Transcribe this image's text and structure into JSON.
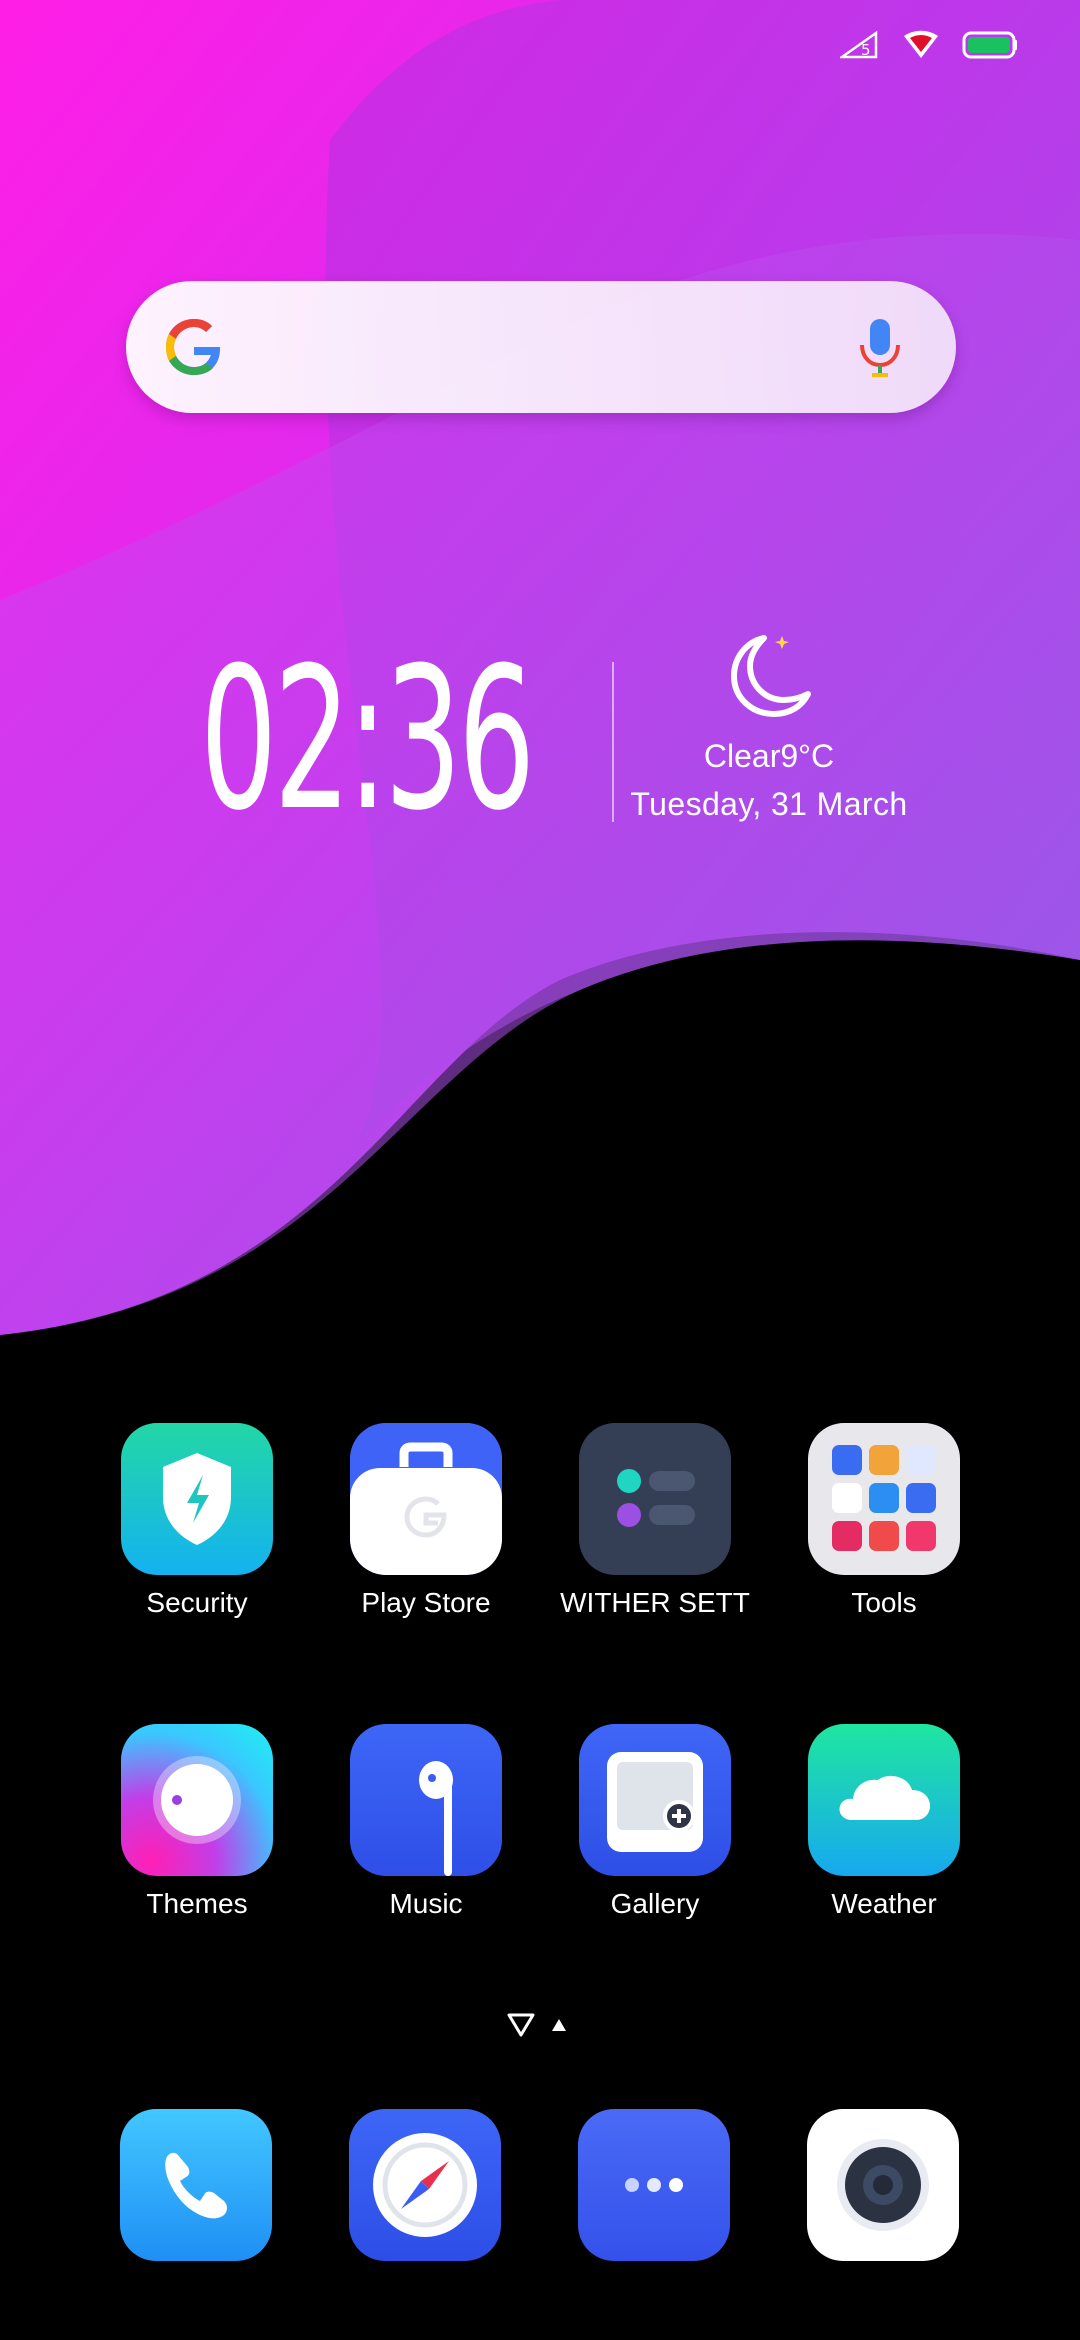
{
  "status_bar": {
    "sim_label": "5",
    "battery_color": "#19c15f"
  },
  "search": {
    "placeholder": ""
  },
  "clock": {
    "time": "02:36",
    "weather": "Clear9°C",
    "date": "Tuesday, 31 March"
  },
  "apps": [
    {
      "label": "Security"
    },
    {
      "label": "Play Store"
    },
    {
      "label": "WITHER SETT"
    },
    {
      "label": "Tools"
    },
    {
      "label": "Themes"
    },
    {
      "label": "Music"
    },
    {
      "label": "Gallery"
    },
    {
      "label": "Weather"
    }
  ],
  "dock": [
    {
      "icon": "phone-icon"
    },
    {
      "icon": "compass-icon"
    },
    {
      "icon": "more-icon"
    },
    {
      "icon": "camera-icon"
    }
  ],
  "colors": {
    "wallpaper_top": "#ff22e8",
    "wallpaper_mid": "#b73df0",
    "wallpaper_bottom": "#8a5ee8",
    "accent_blue": "#3a5cf5"
  }
}
